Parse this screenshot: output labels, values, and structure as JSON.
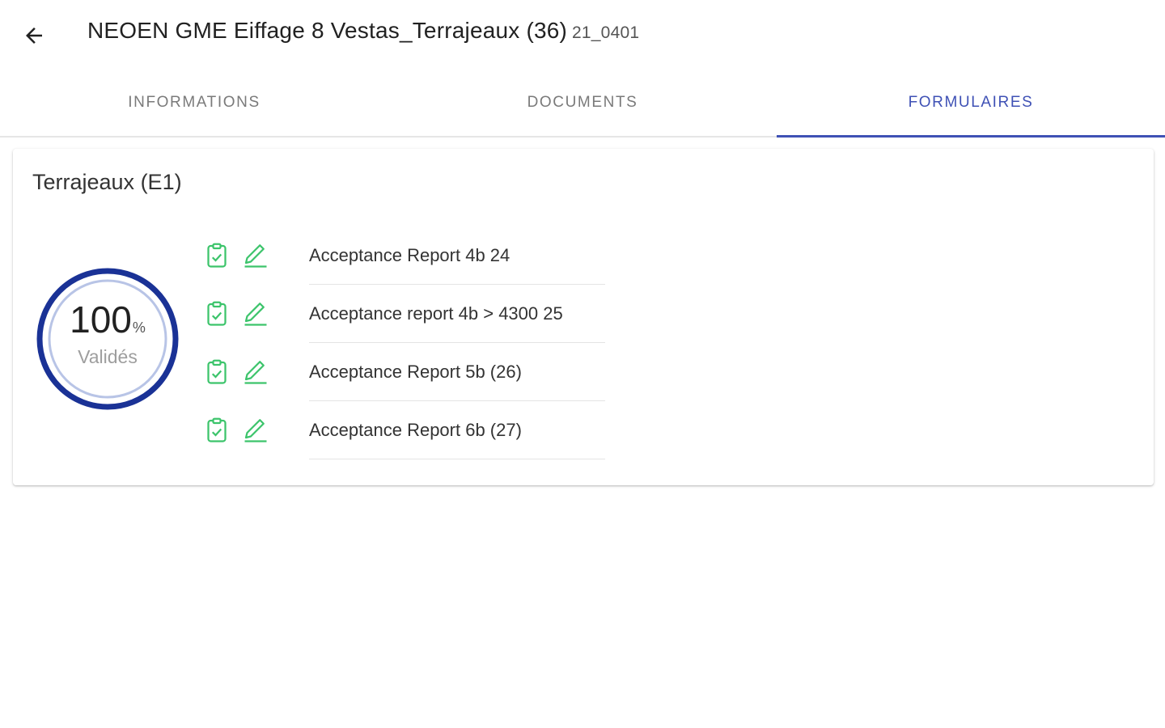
{
  "header": {
    "back_icon": "arrow-left-icon",
    "title": "NEOEN GME Eiffage 8 Vestas_Terrajeaux (36)",
    "code": "21_0401"
  },
  "tabs": [
    {
      "label": "INFORMATIONS",
      "active": false
    },
    {
      "label": "DOCUMENTS",
      "active": false
    },
    {
      "label": "FORMULAIRES",
      "active": true
    }
  ],
  "colors": {
    "accent": "#3f51b5",
    "progress_ring": "#1a3296",
    "progress_inner_ring": "#b8c4e6",
    "icon_green": "#3cc46b"
  },
  "card": {
    "title": "Terrajeaux (E1)",
    "progress": {
      "value": "100",
      "unit": "%",
      "fraction": 1.0,
      "label": "Validés"
    },
    "forms": [
      {
        "label": "Acceptance Report 4b 24",
        "status_icon": "clipboard-check-icon",
        "action_icon": "pencil-icon"
      },
      {
        "label": "Acceptance report 4b > 4300 25",
        "status_icon": "clipboard-check-icon",
        "action_icon": "pencil-icon"
      },
      {
        "label": "Acceptance Report 5b (26)",
        "status_icon": "clipboard-check-icon",
        "action_icon": "pencil-icon"
      },
      {
        "label": "Acceptance Report 6b (27)",
        "status_icon": "clipboard-check-icon",
        "action_icon": "pencil-icon"
      }
    ]
  }
}
